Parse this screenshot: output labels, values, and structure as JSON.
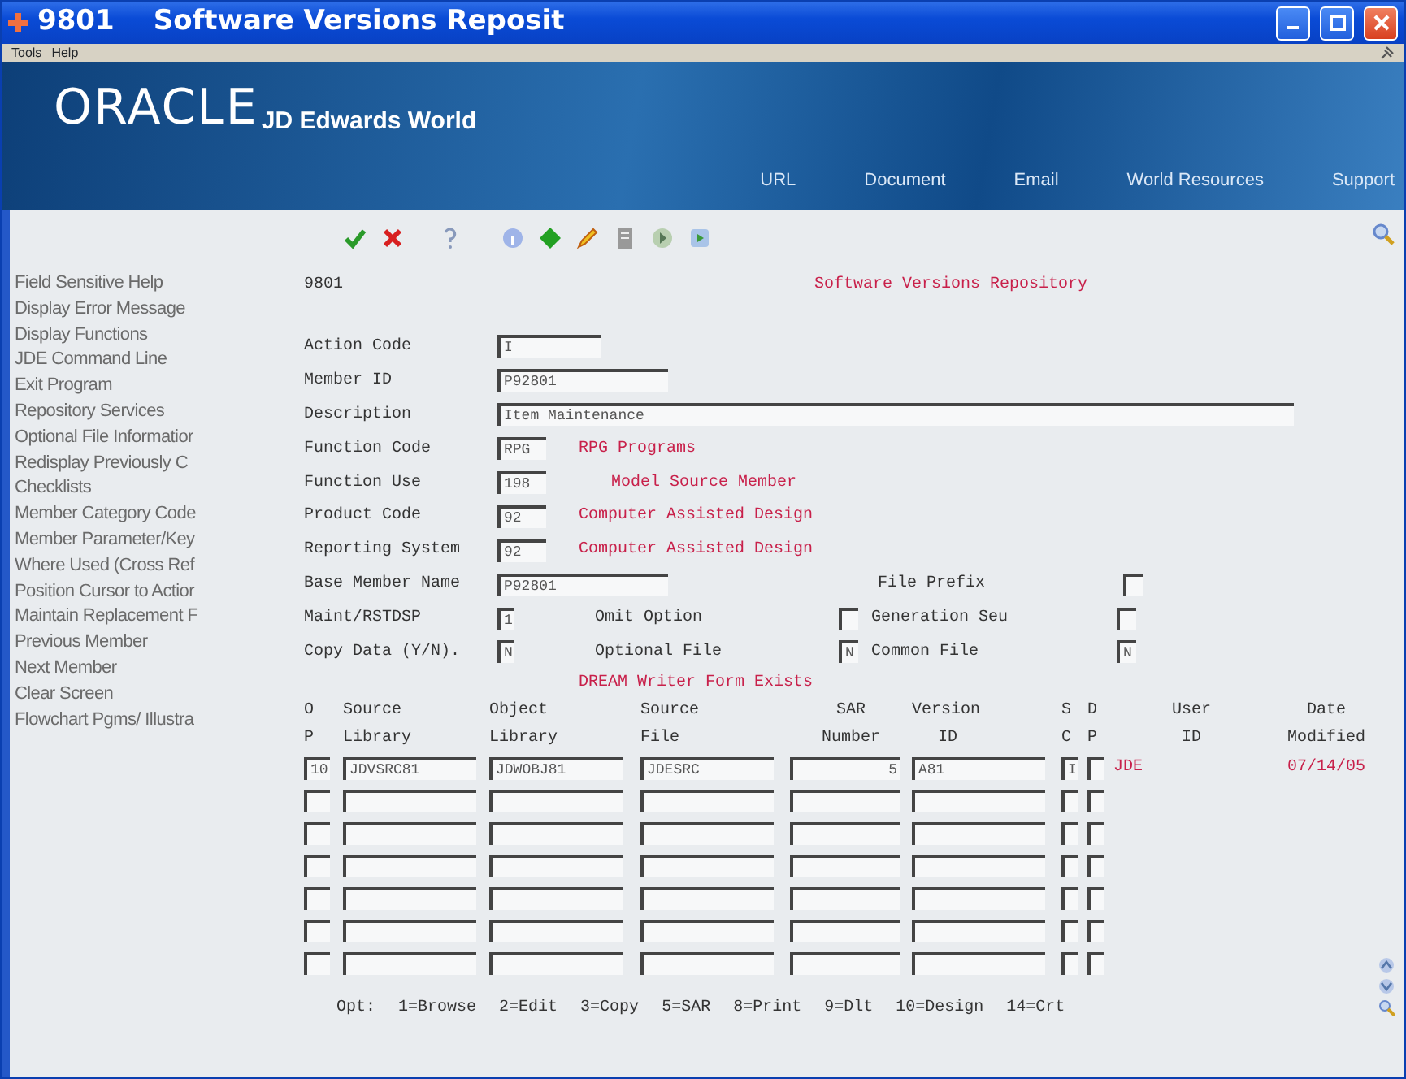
{
  "window": {
    "number": "9801",
    "title": "Software Versions Reposit"
  },
  "menu": [
    "Tools",
    "Help"
  ],
  "brand": {
    "logo": "ORACLE",
    "product": "JD Edwards World"
  },
  "links": [
    "URL",
    "Document",
    "Email",
    "World Resources",
    "Support"
  ],
  "sidebar": {
    "items": [
      "Field Sensitive Help",
      "Display Error Message",
      "Display Functions",
      "JDE Command Line",
      "Exit Program",
      "Repository Services",
      "Optional File Informatior",
      "Redisplay Previously C",
      "Checklists",
      "Member Category Code",
      "Member Parameter/Key",
      "Where Used (Cross Ref",
      "Position Cursor to Actior",
      "Maintain Replacement F",
      "Previous Member",
      "Next Member",
      "Clear Screen",
      "Flowchart Pgms/ Illustra"
    ]
  },
  "form": {
    "program": "9801",
    "heading": "Software Versions Repository",
    "fields": [
      {
        "label": "Action Code",
        "value": "I"
      },
      {
        "label": "Member ID",
        "value": "P92801"
      },
      {
        "label": "Description",
        "value": "Item Maintenance"
      },
      {
        "label": "Function Code",
        "value": "RPG",
        "description": "RPG Programs"
      },
      {
        "label": "Function Use",
        "value": "198",
        "description": "Model Source Member"
      },
      {
        "label": "Product Code",
        "value": "92",
        "description": "Computer Assisted Design"
      },
      {
        "label": "Reporting System",
        "value": "92",
        "description": "Computer Assisted Design"
      },
      {
        "label": "Base Member Name",
        "value": "P92801",
        "right_option": {
          "label": "File Prefix"
        }
      },
      {
        "label": "Maint/RSTDSP",
        "value": "1",
        "left_option": {
          "label": "Omit Option"
        },
        "right_option": {
          "label": "Generation Seu"
        }
      },
      {
        "label": "Copy Data (Y/N).",
        "value": "N",
        "left_option": {
          "label": "Optional File",
          "value": "N"
        },
        "right_option": {
          "label": "Common File",
          "value": "N"
        }
      }
    ],
    "message": "DREAM Writer Form Exists"
  },
  "table": {
    "columns": [
      [
        "O",
        "P"
      ],
      [
        "Source",
        "Library"
      ],
      [
        "Object",
        "Library"
      ],
      [
        "Source",
        "File"
      ],
      [
        "SAR",
        "Number"
      ],
      [
        "Version",
        "ID"
      ],
      [
        "S",
        "C"
      ],
      [
        "D",
        "P"
      ],
      [
        "User",
        "ID"
      ],
      [
        "Date",
        "Modified"
      ]
    ],
    "rows": [
      {
        "kind": "filled",
        "cells": [
          "10",
          "JDVSRC81",
          "JDWOBJ81",
          "JDESRC",
          "5",
          "A81",
          "I",
          null,
          "JDE",
          "07/14/05"
        ]
      },
      {
        "kind": "blank"
      },
      {
        "kind": "blank"
      },
      {
        "kind": "blank"
      },
      {
        "kind": "blank"
      },
      {
        "kind": "blank"
      },
      {
        "kind": "blank"
      }
    ]
  },
  "options": {
    "label": "Opt:",
    "items": [
      "1=Browse",
      "2=Edit",
      "3=Copy",
      "5=SAR",
      "8=Print",
      "9=Dlt",
      "10=Design",
      "14=Crt"
    ]
  }
}
